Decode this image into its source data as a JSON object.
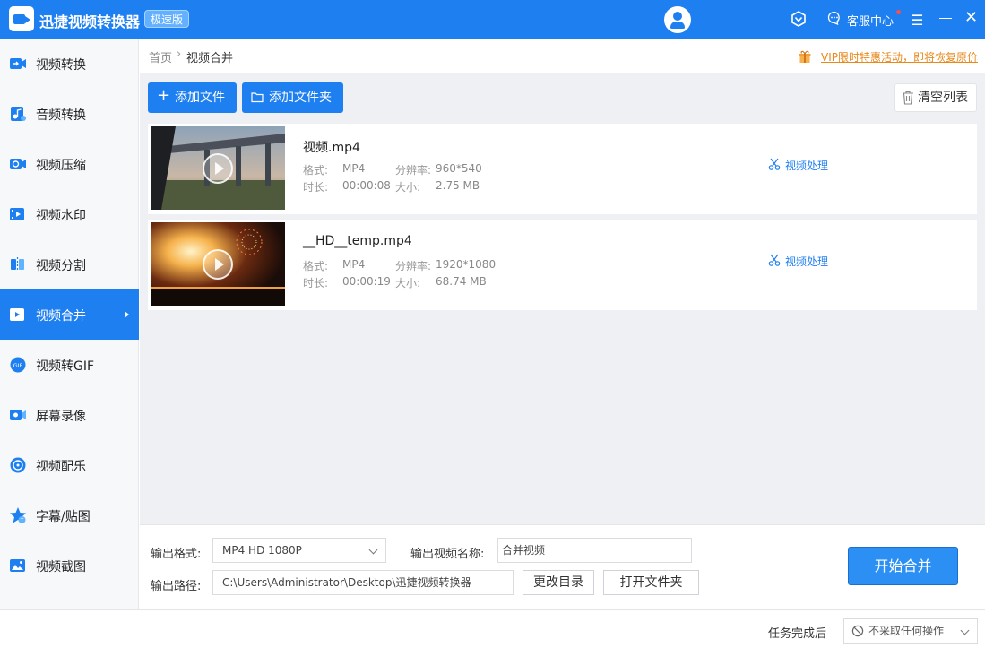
{
  "titlebar": {
    "app_title": "迅捷视频转换器",
    "edition": "极速版",
    "service_label": "客服中心",
    "menu_glyph": "☰",
    "close_glyph": "✕"
  },
  "sidebar": {
    "items": [
      {
        "label": "视频转换",
        "icon": "video-convert-icon"
      },
      {
        "label": "音频转换",
        "icon": "audio-convert-icon"
      },
      {
        "label": "视频压缩",
        "icon": "video-compress-icon"
      },
      {
        "label": "视频水印",
        "icon": "video-watermark-icon"
      },
      {
        "label": "视频分割",
        "icon": "video-split-icon"
      },
      {
        "label": "视频合并",
        "icon": "video-merge-icon",
        "active": true
      },
      {
        "label": "视频转GIF",
        "icon": "video-to-gif-icon"
      },
      {
        "label": "屏幕录像",
        "icon": "screen-record-icon"
      },
      {
        "label": "视频配乐",
        "icon": "video-music-icon"
      },
      {
        "label": "字幕/贴图",
        "icon": "subtitle-sticker-icon"
      },
      {
        "label": "视频截图",
        "icon": "video-screenshot-icon"
      }
    ]
  },
  "breadcrumb": {
    "home": "首页",
    "separator": "›",
    "current": "视频合并"
  },
  "promo": {
    "text": "VIP限时特惠活动，即将恢复原价",
    "color": "#e8891c"
  },
  "toolbar": {
    "add_file": "添加文件",
    "add_folder": "添加文件夹",
    "clear_list": "清空列表",
    "plus_glyph": "+"
  },
  "files": [
    {
      "name": "视频.mp4",
      "format_label": "格式:",
      "format": "MP4",
      "resolution_label": "分辨率:",
      "resolution": "960*540",
      "duration_label": "时长:",
      "duration": "00:00:08",
      "size_label": "大小:",
      "size": "2.75 MB",
      "action": "视频处理"
    },
    {
      "name": "__HD__temp.mp4",
      "format_label": "格式:",
      "format": "MP4",
      "resolution_label": "分辨率:",
      "resolution": "1920*1080",
      "duration_label": "时长:",
      "duration": "00:00:19",
      "size_label": "大小:",
      "size": "68.74 MB",
      "action": "视频处理"
    }
  ],
  "output": {
    "format_label": "输出格式:",
    "format_value": "MP4  HD 1080P",
    "name_label": "输出视频名称:",
    "name_value": "合并视频",
    "path_label": "输出路径:",
    "path_value": "C:\\Users\\Administrator\\Desktop\\迅捷视频转换器",
    "change_dir": "更改目录",
    "open_folder": "打开文件夹",
    "start": "开始合并"
  },
  "status": {
    "after_label": "任务完成后",
    "after_value": "不采取任何操作"
  },
  "colors": {
    "accent": "#1e7ff0",
    "link": "#1e7ff0",
    "promo": "#e8891c"
  }
}
